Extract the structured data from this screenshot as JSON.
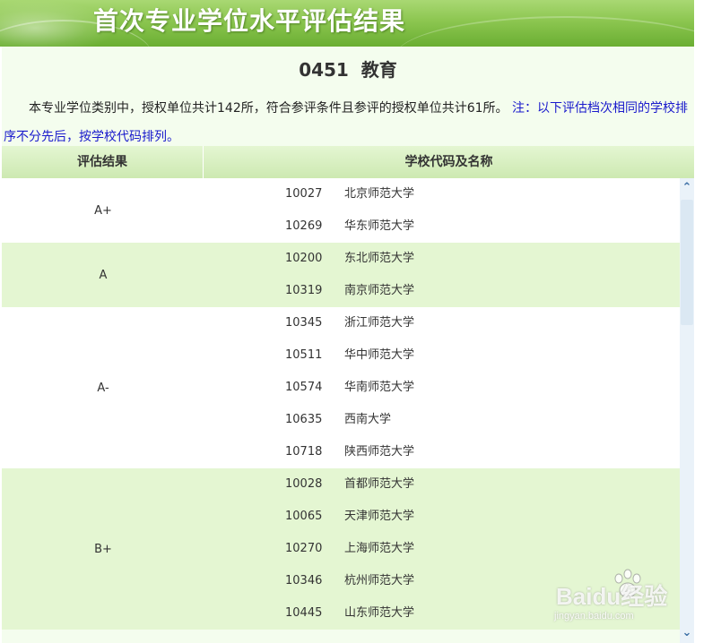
{
  "banner": {
    "title": "首次专业学位水平评估结果"
  },
  "subject": {
    "code": "0451",
    "name": "教育"
  },
  "intro": {
    "text": "本专业学位类别中，授权单位共计142所，符合参评条件且参评的授权单位共计61所。",
    "note": "注：以下评估档次相同的学校排序不分先后，按学校代码排列。"
  },
  "table": {
    "headers": {
      "grade": "评估结果",
      "school": "学校代码及名称"
    },
    "groups": [
      {
        "grade": "A+",
        "rows": [
          {
            "code": "10027",
            "name": "北京师范大学"
          },
          {
            "code": "10269",
            "name": "华东师范大学"
          }
        ]
      },
      {
        "grade": "A",
        "rows": [
          {
            "code": "10200",
            "name": "东北师范大学"
          },
          {
            "code": "10319",
            "name": "南京师范大学"
          }
        ]
      },
      {
        "grade": "A-",
        "rows": [
          {
            "code": "10345",
            "name": "浙江师范大学"
          },
          {
            "code": "10511",
            "name": "华中师范大学"
          },
          {
            "code": "10574",
            "name": "华南师范大学"
          },
          {
            "code": "10635",
            "name": "西南大学"
          },
          {
            "code": "10718",
            "name": "陕西师范大学"
          }
        ]
      },
      {
        "grade": "B+",
        "rows": [
          {
            "code": "10028",
            "name": "首都师范大学"
          },
          {
            "code": "10065",
            "name": "天津师范大学"
          },
          {
            "code": "10270",
            "name": "上海师范大学"
          },
          {
            "code": "10346",
            "name": "杭州师范大学"
          },
          {
            "code": "10445",
            "name": "山东师范大学"
          }
        ]
      }
    ]
  },
  "scrollbar": {
    "up_icon": "chevron-up-icon",
    "down_icon": "chevron-down-icon"
  },
  "watermark": {
    "brand": "Baidu经验",
    "url": "jingyan.baidu.com"
  },
  "colors": {
    "banner": "#8cc650",
    "header_row": "#cde9b1",
    "alt_row": "#e4f6d2",
    "note": "#1a1acc"
  }
}
